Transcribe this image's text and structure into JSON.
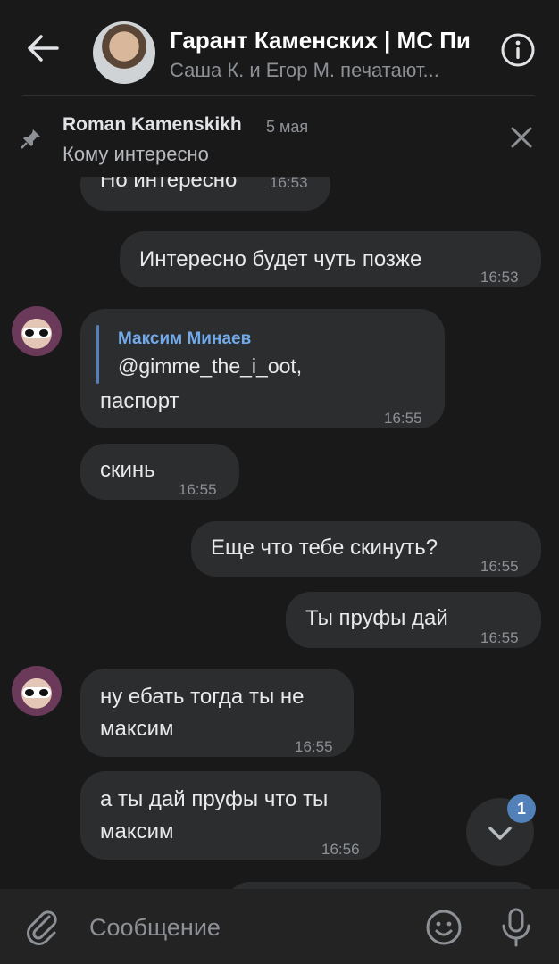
{
  "header": {
    "title": "Гарант Каменских | МС Пи",
    "subtitle": "Саша К. и Егор М. печатают..."
  },
  "pinned": {
    "author": "Roman Kamenskikh",
    "date": "5 мая",
    "text": "Кому интересно"
  },
  "messages": [
    {
      "text": "Но интересно",
      "time": "16:53"
    },
    {
      "text": "Интересно будет чуть позже",
      "time": "16:53"
    },
    {
      "reply_name": "Максим Минаев",
      "reply_text": "@gimme_the_i_oot,",
      "text": "паспорт",
      "time": "16:55"
    },
    {
      "text": "скинь",
      "time": "16:55"
    },
    {
      "text": "Еще что тебе скинуть?",
      "time": "16:55"
    },
    {
      "text": "Ты пруфы дай",
      "time": "16:55"
    },
    {
      "line1": "ну ебать тогда ты не",
      "line2": "максим",
      "time": "16:55"
    },
    {
      "line1": "а ты дай пруфы что ты",
      "line2": "максим",
      "time": "16:56"
    }
  ],
  "scroll_badge": "1",
  "composer": {
    "placeholder": "Сообщение"
  }
}
